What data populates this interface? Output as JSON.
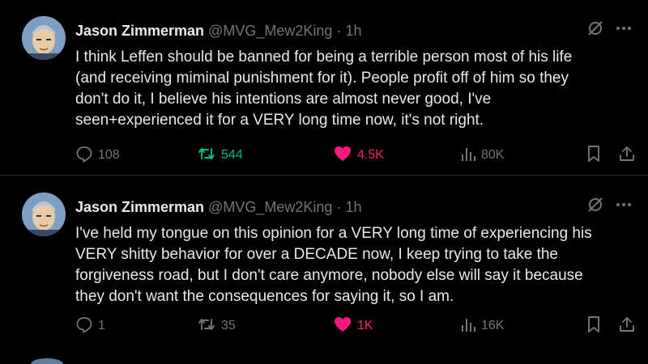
{
  "tweets": [
    {
      "author_name": "Jason Zimmerman",
      "handle": "@MVG_Mew2King",
      "separator": "·",
      "time": "1h",
      "text": "I think Leffen should be banned for being a terrible person most of his life\n(and receiving miminal punishment for it). People profit off of him so they\ndon't do it, I believe his intentions are almost never good, I've\nseen+experienced it for a VERY long time now, it's not right.",
      "replies": "108",
      "reposts": "544",
      "reposted": true,
      "likes": "4.5K",
      "liked": true,
      "views": "80K"
    },
    {
      "author_name": "Jason Zimmerman",
      "handle": "@MVG_Mew2King",
      "separator": "·",
      "time": "1h",
      "text": "I've held my tongue on this opinion for a VERY long time of experiencing his\nVERY shitty behavior for over a DECADE now, I keep trying to take the\nforgiveness road, but I don't care anymore, nobody else will say it because\nthey don't want the consequences for saying it, so I am.",
      "replies": "1",
      "reposts": "35",
      "reposted": false,
      "likes": "1K",
      "liked": true,
      "views": "16K"
    }
  ],
  "icons": {
    "grok": "grok-slash-icon",
    "more": "more-dots-icon",
    "reply": "speech-bubble-icon",
    "repost": "repost-arrows-icon",
    "like": "heart-icon",
    "views": "bar-chart-icon",
    "bookmark": "bookmark-icon",
    "share": "share-upload-icon"
  },
  "colors": {
    "background": "#000000",
    "text": "#e7e9ea",
    "muted": "#71767b",
    "repost_active": "#00ba7c",
    "like_active": "#f91880",
    "divider": "#2f3336"
  }
}
